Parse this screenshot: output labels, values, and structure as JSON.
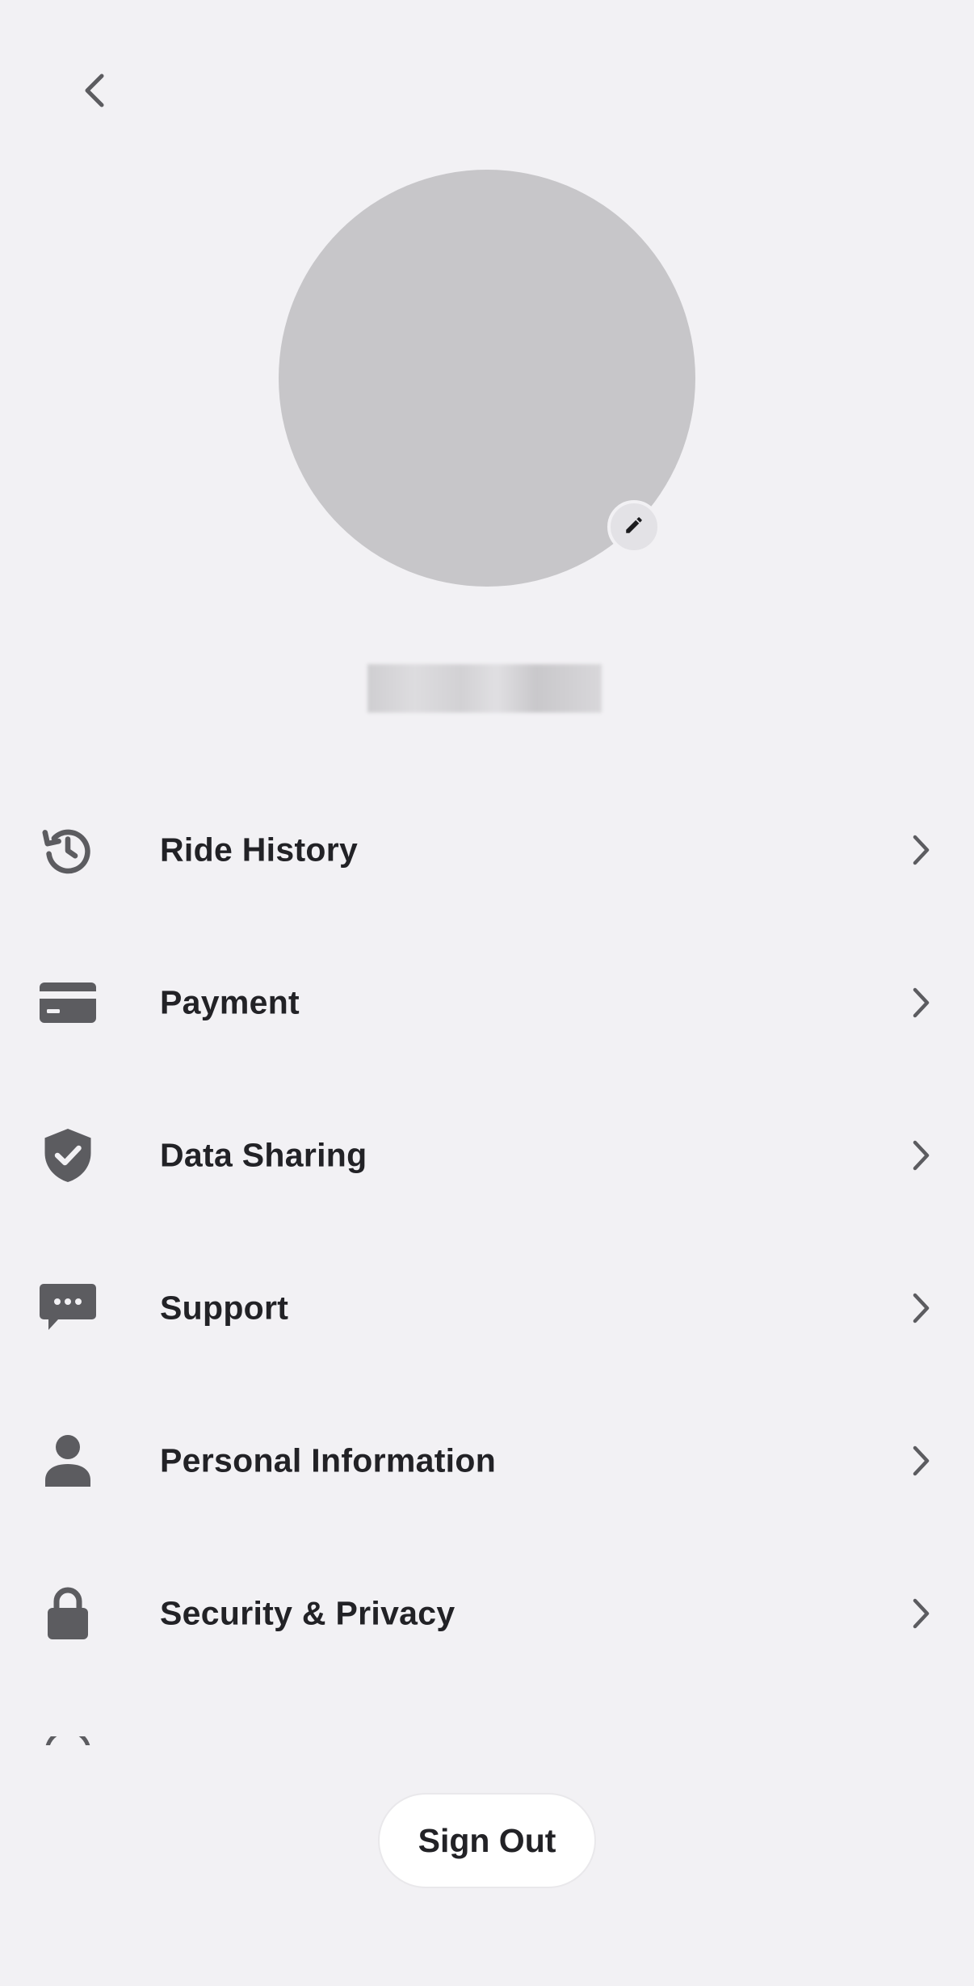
{
  "header": {
    "back_icon": "chevron-left-icon"
  },
  "profile": {
    "avatar": "avatar-placeholder",
    "edit_icon": "pencil-icon",
    "name": "",
    "name_obscured": true
  },
  "menu": {
    "items": [
      {
        "label": "Ride History",
        "icon": "history-icon"
      },
      {
        "label": "Payment",
        "icon": "credit-card-icon"
      },
      {
        "label": "Data Sharing",
        "icon": "shield-check-icon"
      },
      {
        "label": "Support",
        "icon": "chat-bubble-icon"
      },
      {
        "label": "Personal Information",
        "icon": "person-icon"
      },
      {
        "label": "Security & Privacy",
        "icon": "lock-icon"
      }
    ],
    "chevron_icon": "chevron-right-icon"
  },
  "footer": {
    "sign_out_label": "Sign Out"
  },
  "colors": {
    "background": "#f2f1f4",
    "icon": "#5c5c60",
    "text": "#222226",
    "avatar": "#c7c6c9",
    "button_bg": "#ffffff"
  }
}
